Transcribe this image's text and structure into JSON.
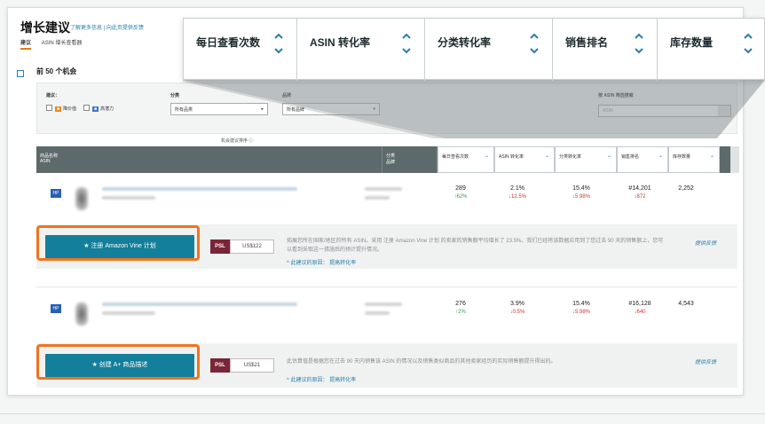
{
  "page": {
    "title": "增长建议",
    "header_links": "了解更多信息 | 向此页提供反馈",
    "tabs": [
      "建议",
      "ASIN 增长查看器"
    ],
    "opportunities": "前 50 个机会",
    "table_caption": "机会建议排序 ⓘ"
  },
  "filters": {
    "type_label": "建议：",
    "option1": "降价值",
    "option2": "高潜力",
    "category_label": "分类",
    "category_value": "所有品类",
    "status_label": "品牌",
    "status_value": "所有品牌",
    "search_label": "按 ASIN 筛选搜索",
    "search_placeholder": "ASIN"
  },
  "table": {
    "col_product": "商品名称",
    "col_product_sub": "ASIN",
    "col_category": "分类",
    "col_category_sub": "品牌",
    "metric_headers": [
      "每日查看次数",
      "ASIN 转化率",
      "分类转化率",
      "销售排名",
      "库存数量"
    ]
  },
  "rows": [
    {
      "logo": "HP",
      "views": "289",
      "views_delta": "↑62%",
      "asin_cvr": "2.1%",
      "asin_cvr_delta": "↓12.5%",
      "cat_cvr": "15.4%",
      "cat_cvr_delta": "↓5.98%",
      "rank": "#14,201",
      "rank_delta": "↓872",
      "stock": "2,252",
      "cta": "★  注册 Amazon Vine 计划",
      "psl": "PSL",
      "price": "US$122",
      "text": "拓展您所在国家/地区的所有 ASIN。采用 注册 Amazon Vine 计划 的卖家的销售额平均增长了 23.5%。我们已经将该数据应用到了您过去 90 天的销售额上，您可以看到采取这一措施后的预计提升情况。",
      "link": "^ 此建议的原因： 提高转化率",
      "feedback": "提供反馈"
    },
    {
      "logo": "HP",
      "views": "276",
      "views_delta": "↑2%",
      "asin_cvr": "3.9%",
      "asin_cvr_delta": "↓0.5%",
      "cat_cvr": "15.4%",
      "cat_cvr_delta": "↓5.98%",
      "rank": "#16,128",
      "rank_delta": "↓640",
      "stock": "4,543",
      "cta": "★  创建 A+ 商品描述",
      "psl": "PSL",
      "price": "US$21",
      "text": "此估算值是根据您在过去 90 天内销售该 ASIN 的情况以及销售类似商品的其他卖家经历的实际销售额提升得出的。",
      "link": "^ 此建议的原因： 提高转化率",
      "feedback": "提供反馈"
    }
  ],
  "zoom": {
    "headers": [
      "每日查看次数",
      "ASIN 转化率",
      "分类转化率",
      "销售排名",
      "库存数量"
    ]
  },
  "colors": {
    "accent_teal": "#137f9b",
    "highlight_orange": "#ef7420",
    "psl_maroon": "#7a2438",
    "up_green": "#2e9e46",
    "down_red": "#d0342c"
  }
}
